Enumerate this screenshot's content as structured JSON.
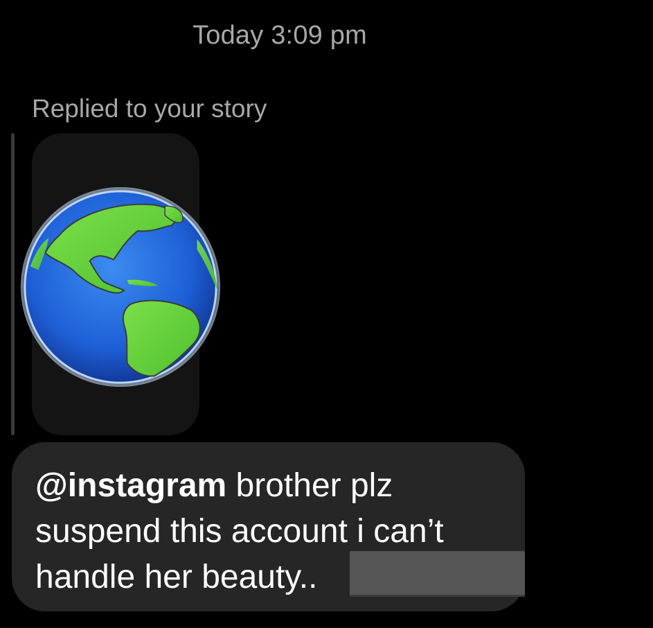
{
  "header": {
    "timestamp": "Today 3:09 pm"
  },
  "reply": {
    "label": "Replied to your story"
  },
  "story": {
    "image_icon": "globe-americas-icon"
  },
  "message": {
    "mention": "@instagram",
    "line1_rest": " brother plz",
    "line2": "suspend this account i can’t",
    "line3": "handle her beauty.."
  },
  "colors": {
    "background": "#000000",
    "bubble": "#262626",
    "muted_text": "#a8a8a8",
    "redaction": "#555555"
  }
}
